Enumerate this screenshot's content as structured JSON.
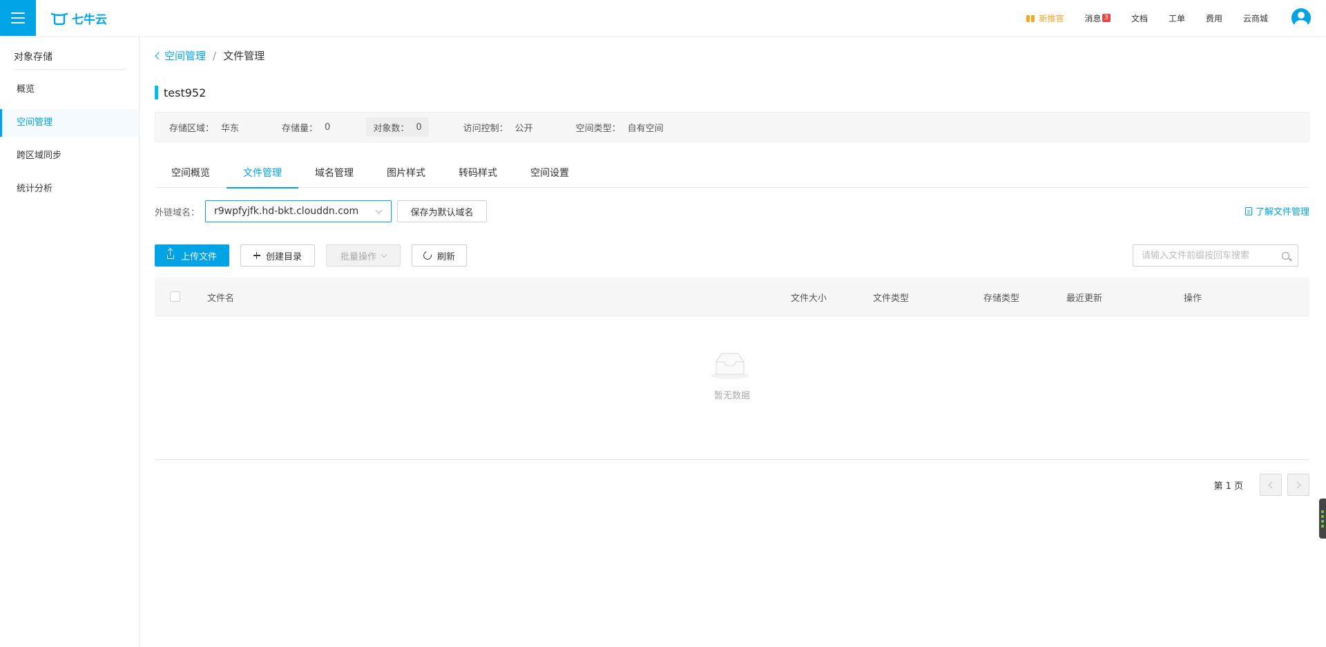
{
  "header": {
    "logo_text": "七牛云",
    "promo": "新推官",
    "messages_label": "消息",
    "messages_count": "3",
    "docs": "文档",
    "tickets": "工单",
    "billing": "费用",
    "marketplace": "云商城"
  },
  "sidebar": {
    "title": "对象存储",
    "items": [
      {
        "label": "概览"
      },
      {
        "label": "空间管理"
      },
      {
        "label": "跨区域同步"
      },
      {
        "label": "统计分析"
      }
    ]
  },
  "breadcrumb": {
    "back": "空间管理",
    "separator": "/",
    "current": "文件管理"
  },
  "bucket": {
    "name": "test952",
    "region_label": "存储区域：",
    "region": "华东",
    "storage_label": "存储量：",
    "storage": "0",
    "objects_label": "对象数：",
    "objects": "0",
    "access_label": "访问控制：",
    "access": "公开",
    "type_label": "空间类型：",
    "type": "自有空间"
  },
  "tabs": [
    "空间概览",
    "文件管理",
    "域名管理",
    "图片样式",
    "转码样式",
    "空间设置"
  ],
  "domain": {
    "label": "外链域名：",
    "value": "r9wpfyjfk.hd-bkt.clouddn.com",
    "save_default": "保存为默认域名",
    "learn_link": "了解文件管理"
  },
  "actions": {
    "upload": "上传文件",
    "create_dir": "创建目录",
    "batch": "批量操作",
    "refresh": "刷新",
    "search_placeholder": "请输入文件前缀按回车搜索"
  },
  "table": {
    "columns": {
      "name": "文件名",
      "size": "文件大小",
      "type": "文件类型",
      "storage_type": "存储类型",
      "updated": "最近更新",
      "ops": "操作"
    },
    "empty_text": "暂无数据"
  },
  "pager": {
    "page_text": "第 1 页"
  },
  "colors": {
    "accent": "#00a4e4",
    "promo": "#f5a623",
    "badge": "#e64545"
  }
}
